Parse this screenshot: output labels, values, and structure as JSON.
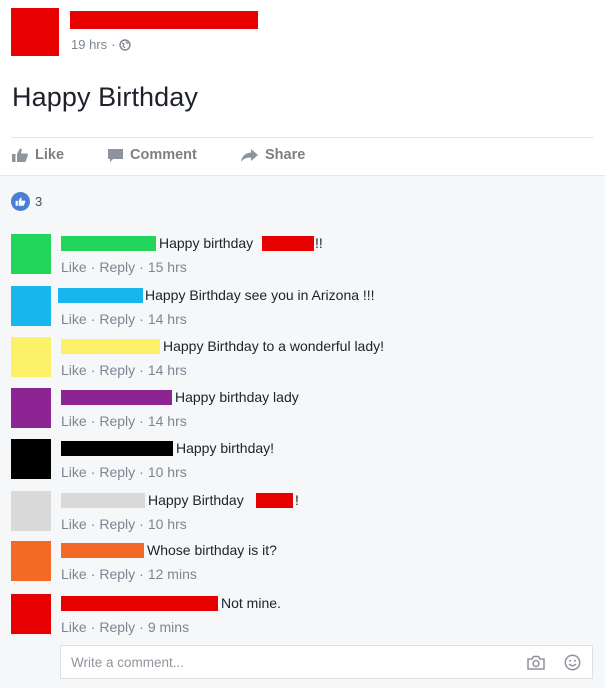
{
  "post": {
    "timestamp": "19 hrs",
    "separator": "·",
    "privacy_icon": "globe-icon",
    "text": "Happy Birthday"
  },
  "actions": {
    "like": "Like",
    "comment": "Comment",
    "share": "Share"
  },
  "reactions": {
    "icon": "thumbs-up-icon",
    "count": "3"
  },
  "comments": [
    {
      "avatar_color": "#22d65b",
      "text": "Happy birthday",
      "suffix": "!!",
      "like": "Like",
      "reply": "Reply",
      "time": "15 hrs"
    },
    {
      "avatar_color": "#17b6ef",
      "text": "Happy Birthday see you in Arizona !!!",
      "like": "Like",
      "reply": "Reply",
      "time": "14 hrs"
    },
    {
      "avatar_color": "#fbf26a",
      "text": "Happy Birthday to a wonderful lady!",
      "like": "Like",
      "reply": "Reply",
      "time": "14 hrs"
    },
    {
      "avatar_color": "#8d2493",
      "text": "Happy birthday lady",
      "like": "Like",
      "reply": "Reply",
      "time": "14 hrs"
    },
    {
      "avatar_color": "#000000",
      "text": "Happy birthday!",
      "like": "Like",
      "reply": "Reply",
      "time": "10 hrs"
    },
    {
      "avatar_color": "#d9d9d9",
      "text": "Happy Birthday",
      "suffix": "!",
      "like": "Like",
      "reply": "Reply",
      "time": "10 hrs"
    },
    {
      "avatar_color": "#f26a25",
      "text": "Whose birthday is it?",
      "like": "Like",
      "reply": "Reply",
      "time": "12 mins"
    },
    {
      "avatar_color": "#e70000",
      "text": "Not mine.",
      "like": "Like",
      "reply": "Reply",
      "time": "9 mins"
    }
  ],
  "write_comment": {
    "placeholder": "Write a comment...",
    "camera_icon": "camera-icon",
    "emoji_icon": "emoji-icon"
  },
  "colors": {
    "redaction": "#e70000",
    "muted_text": "#7d8592",
    "like_badge": "#4a7fd4"
  }
}
